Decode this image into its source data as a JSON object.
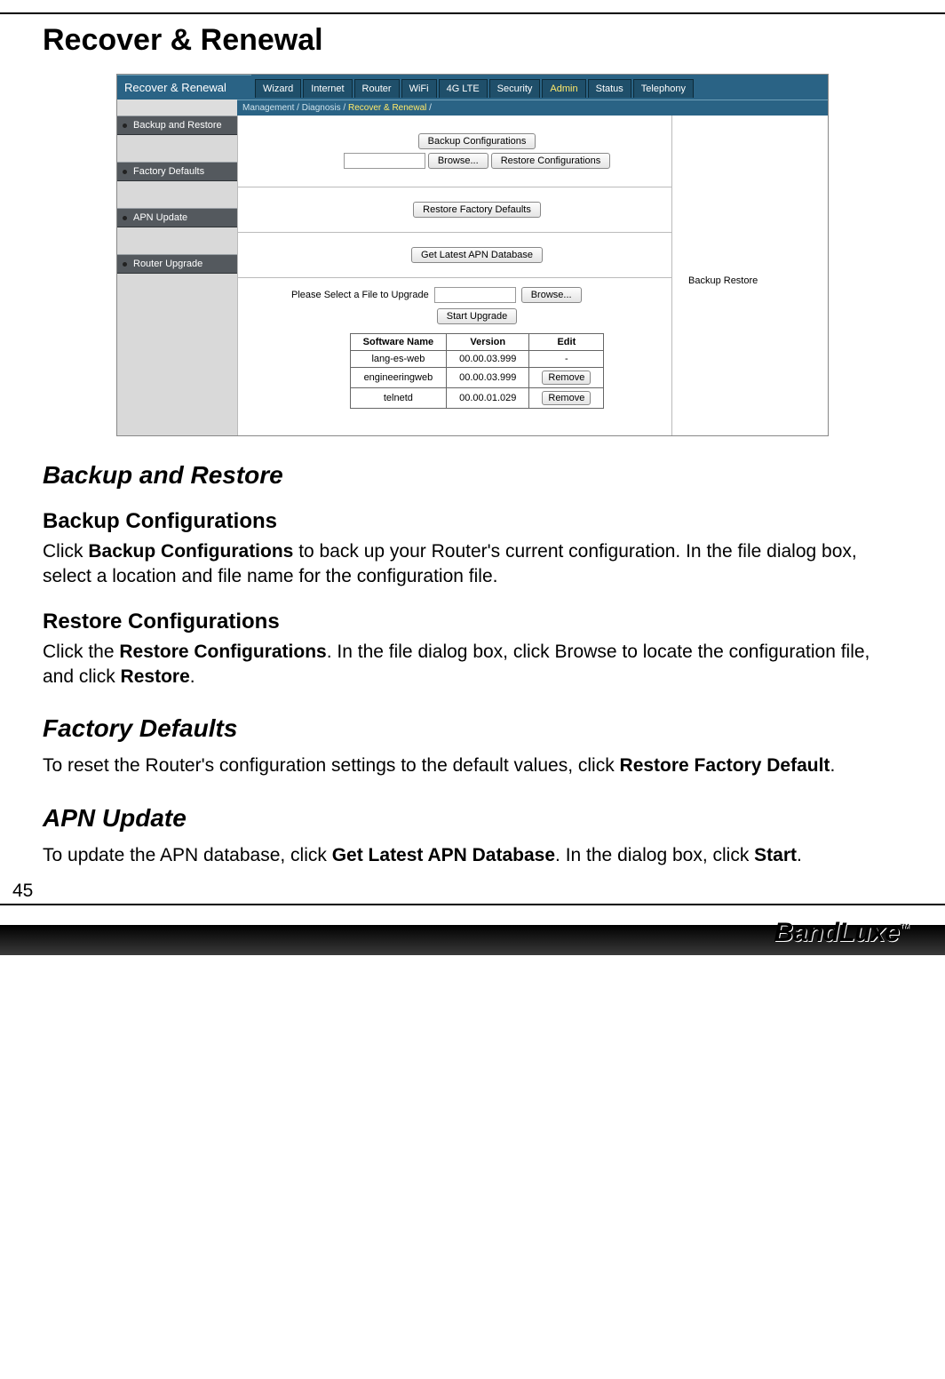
{
  "page_number": "45",
  "brand": "BandLuxe",
  "brand_tm": "™",
  "headings": {
    "h1": "Recover & Renewal",
    "h2a": "Backup and Restore",
    "h3a": "Backup Configurations",
    "h3b": "Restore Configurations",
    "h2b": "Factory Defaults",
    "h2c": "APN Update"
  },
  "paragraphs": {
    "p1_a": "Click ",
    "p1_b": "Backup Configurations",
    "p1_c": " to back up your Router's current configuration. In the file dialog box, select a location and file name for the configuration file.",
    "p2_a": "Click the ",
    "p2_b": "Restore Configurations",
    "p2_c": ". In the file dialog box, click Browse to locate the configuration file, and click ",
    "p2_d": "Restore",
    "p2_e": ".",
    "p3_a": "To reset the Router's configuration settings to the default values, click ",
    "p3_b": "Restore Factory Default",
    "p3_c": ".",
    "p4_a": "To update the APN database, click ",
    "p4_b": "Get Latest APN Database",
    "p4_c": ". In the dialog box, click ",
    "p4_d": "Start",
    "p4_e": "."
  },
  "router": {
    "title": "Recover & Renewal",
    "tabs": [
      "Wizard",
      "Internet",
      "Router",
      "WiFi",
      "4G LTE",
      "Security",
      "Admin",
      "Status",
      "Telephony"
    ],
    "active_tab_index": 6,
    "breadcrumb": [
      "Management",
      "Diagnosis",
      "Recover & Renewal"
    ],
    "sidebar": [
      "Backup and Restore",
      "Factory Defaults",
      "APN Update",
      "Router Upgrade"
    ],
    "right_label": "Backup Restore",
    "buttons": {
      "backup": "Backup Configurations",
      "browse": "Browse...",
      "restore": "Restore  Configurations",
      "factory": "Restore Factory Defaults",
      "apn": "Get Latest APN Database",
      "upgrade_label": "Please Select a File to Upgrade",
      "start_upgrade": "Start Upgrade",
      "remove": "Remove"
    },
    "table": {
      "headers": [
        "Software Name",
        "Version",
        "Edit"
      ],
      "rows": [
        {
          "name": "lang-es-web",
          "version": "00.00.03.999",
          "edit": "-"
        },
        {
          "name": "engineeringweb",
          "version": "00.00.03.999",
          "edit": "remove"
        },
        {
          "name": "telnetd",
          "version": "00.00.01.029",
          "edit": "remove"
        }
      ]
    }
  }
}
